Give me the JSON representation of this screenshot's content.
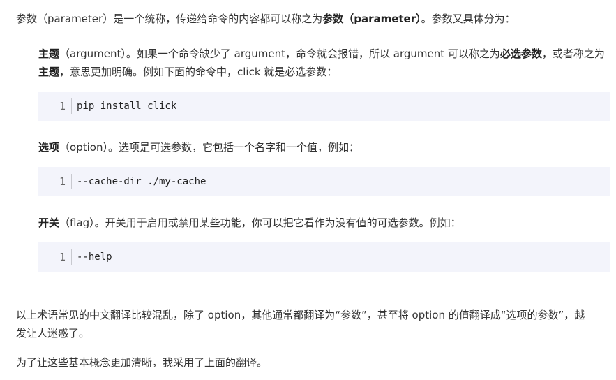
{
  "intro": {
    "part1": "参数（parameter）是一个统称，传递给命令的内容都可以称之为",
    "bold1": "参数（parameter）",
    "part2": "。参数又具体分为："
  },
  "argument": {
    "term": "主题",
    "part1": "（argument）。如果一个命令缺少了 argument，命令就会报错，所以 argument 可以称之为",
    "bold_required": "必选参数",
    "part2": "，或者称之为",
    "bold_term": "主题",
    "part3": "，意思更加明确。例如下面的命令中，click 就是必选参数："
  },
  "code1": {
    "line_no": "1",
    "code": "pip install click"
  },
  "option": {
    "term": "选项",
    "text": "（option）。选项是可选参数，它包括一个名字和一个值，例如："
  },
  "code2": {
    "line_no": "1",
    "code": "--cache-dir ./my-cache"
  },
  "flag": {
    "term": "开关",
    "text": "（flag）。开关用于启用或禁用某些功能，你可以把它看作为没有值的可选参数。例如："
  },
  "code3": {
    "line_no": "1",
    "code": "--help"
  },
  "note1": "以上术语常见的中文翻译比较混乱，除了 option，其他通常都翻译为“参数”，甚至将 option 的值翻译成“选项的参数”，越发让人迷惑了。",
  "note2": "为了让这些基本概念更加清晰，我采用了上面的翻译。"
}
